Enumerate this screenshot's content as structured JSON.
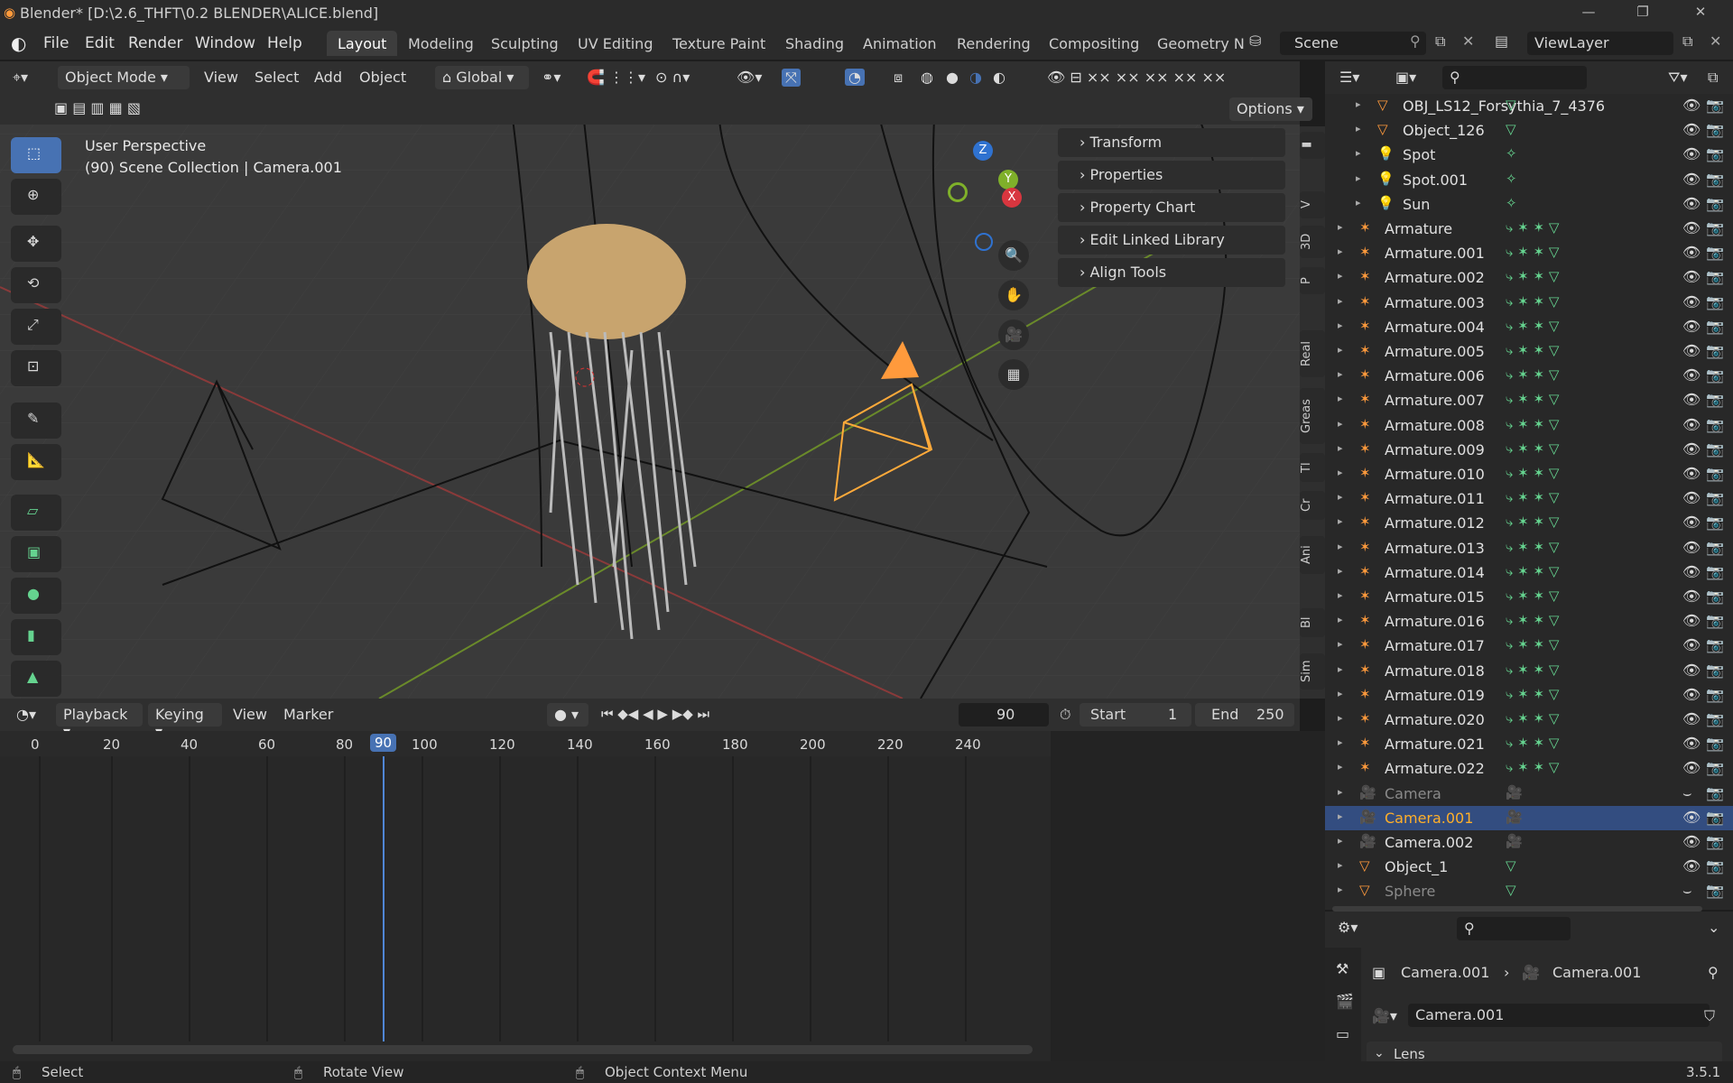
{
  "titlebar": {
    "title": "Blender* [D:\\2.6_THFT\\0.2 BLENDER\\ALICE.blend]"
  },
  "menus": [
    "File",
    "Edit",
    "Render",
    "Window",
    "Help"
  ],
  "workspaces": [
    "Layout",
    "Modeling",
    "Sculpting",
    "UV Editing",
    "Texture Paint",
    "Shading",
    "Animation",
    "Rendering",
    "Compositing",
    "Geometry N"
  ],
  "scene": {
    "name": "Scene",
    "view_layer": "ViewLayer"
  },
  "viewport_header": {
    "mode": "Object Mode",
    "menus": [
      "View",
      "Select",
      "Add",
      "Object"
    ],
    "orientation": "Global",
    "options": "Options"
  },
  "viewport": {
    "perspective": "User Perspective",
    "collection": "(90) Scene Collection | Camera.001"
  },
  "npanel": [
    "Transform",
    "Properties",
    "Property Chart",
    "Edit Linked Library",
    "Align Tools"
  ],
  "vtabs": [
    "V",
    "3D",
    "P",
    "Real",
    "Greas",
    "Tl",
    "Cr",
    "Ani",
    "Bl",
    "Sim"
  ],
  "timeline": {
    "menus": [
      "Playback",
      "Keying",
      "View",
      "Marker"
    ],
    "current_frame": "90",
    "start_label": "Start",
    "start": "1",
    "end_label": "End",
    "end": "250",
    "ticks": [
      "0",
      "20",
      "40",
      "60",
      "80",
      "90",
      "100",
      "120",
      "140",
      "160",
      "180",
      "200",
      "220",
      "240"
    ]
  },
  "outliner": {
    "rows": [
      {
        "name": "OBJ_LS12_Forsythia_7_4376",
        "type": "mesh",
        "state": "normal"
      },
      {
        "name": "Object_126",
        "type": "mesh",
        "state": "normal"
      },
      {
        "name": "Spot",
        "type": "light",
        "state": "normal"
      },
      {
        "name": "Spot.001",
        "type": "light",
        "state": "normal"
      },
      {
        "name": "Sun",
        "type": "light",
        "state": "normal"
      },
      {
        "name": "Armature",
        "type": "armature",
        "state": "normal"
      },
      {
        "name": "Armature.001",
        "type": "armature",
        "state": "normal"
      },
      {
        "name": "Armature.002",
        "type": "armature",
        "state": "normal"
      },
      {
        "name": "Armature.003",
        "type": "armature",
        "state": "normal"
      },
      {
        "name": "Armature.004",
        "type": "armature",
        "state": "normal"
      },
      {
        "name": "Armature.005",
        "type": "armature",
        "state": "normal"
      },
      {
        "name": "Armature.006",
        "type": "armature",
        "state": "normal"
      },
      {
        "name": "Armature.007",
        "type": "armature",
        "state": "normal"
      },
      {
        "name": "Armature.008",
        "type": "armature",
        "state": "normal"
      },
      {
        "name": "Armature.009",
        "type": "armature",
        "state": "normal"
      },
      {
        "name": "Armature.010",
        "type": "armature",
        "state": "normal"
      },
      {
        "name": "Armature.011",
        "type": "armature",
        "state": "normal"
      },
      {
        "name": "Armature.012",
        "type": "armature",
        "state": "normal"
      },
      {
        "name": "Armature.013",
        "type": "armature",
        "state": "normal"
      },
      {
        "name": "Armature.014",
        "type": "armature",
        "state": "normal"
      },
      {
        "name": "Armature.015",
        "type": "armature",
        "state": "normal"
      },
      {
        "name": "Armature.016",
        "type": "armature",
        "state": "normal"
      },
      {
        "name": "Armature.017",
        "type": "armature",
        "state": "normal"
      },
      {
        "name": "Armature.018",
        "type": "armature",
        "state": "normal"
      },
      {
        "name": "Armature.019",
        "type": "armature",
        "state": "normal"
      },
      {
        "name": "Armature.020",
        "type": "armature",
        "state": "normal"
      },
      {
        "name": "Armature.021",
        "type": "armature",
        "state": "normal"
      },
      {
        "name": "Armature.022",
        "type": "armature",
        "state": "normal"
      },
      {
        "name": "Camera",
        "type": "camera",
        "state": "dim"
      },
      {
        "name": "Camera.001",
        "type": "camera",
        "state": "active"
      },
      {
        "name": "Camera.002",
        "type": "camera",
        "state": "normal"
      },
      {
        "name": "Object_1",
        "type": "mesh",
        "state": "normal"
      },
      {
        "name": "Sphere",
        "type": "mesh",
        "state": "dim"
      }
    ]
  },
  "properties": {
    "breadcrumb_object": "Camera.001",
    "breadcrumb_data": "Camera.001",
    "data_name": "Camera.001",
    "panel": "Lens"
  },
  "statusbar": {
    "select": "Select",
    "rotate": "Rotate View",
    "context": "Object Context Menu",
    "version": "3.5.1"
  },
  "colors": {
    "accent": "#4772b3",
    "active_object": "#ffaf29",
    "selection": "#334d80"
  }
}
